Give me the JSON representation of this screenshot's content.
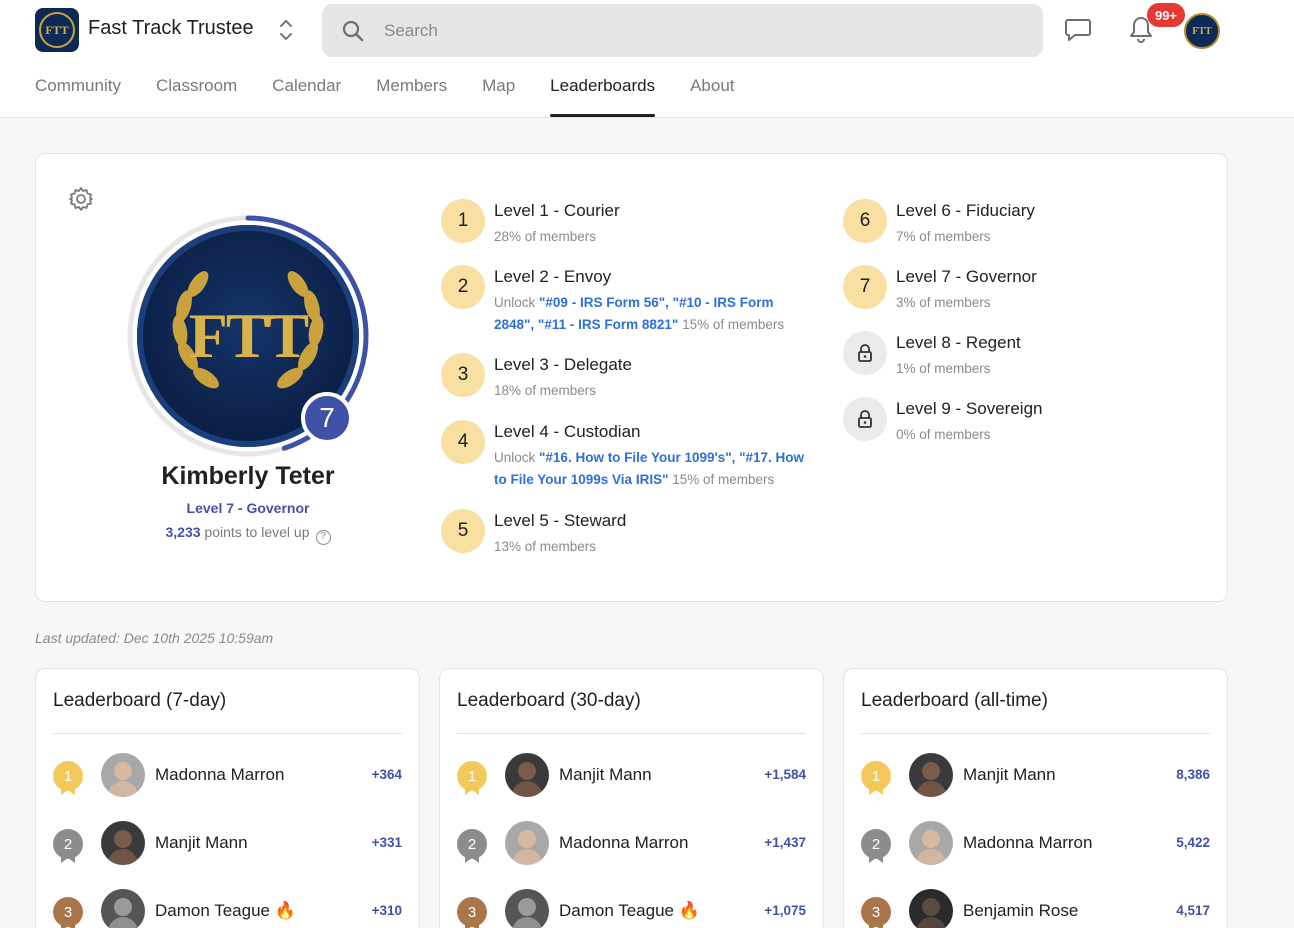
{
  "header": {
    "brand": "Fast Track Trustee",
    "logo_text": "FTT",
    "search_placeholder": "Search",
    "notification_count": "99+",
    "tabs": [
      {
        "label": "Community"
      },
      {
        "label": "Classroom"
      },
      {
        "label": "Calendar"
      },
      {
        "label": "Members"
      },
      {
        "label": "Map"
      },
      {
        "label": "Leaderboards",
        "active": true
      },
      {
        "label": "About"
      }
    ]
  },
  "profile": {
    "avatar_text": "FTT",
    "level_number": "7",
    "name": "Kimberly Teter",
    "level_label": "Level 7 - Governor",
    "points_value": "3,233",
    "points_suffix": "points to level up",
    "level_progress_fraction": 0.45
  },
  "levels": [
    {
      "num": "1",
      "title": "Level 1 - Courier",
      "pct": "28% of members",
      "locked": false
    },
    {
      "num": "2",
      "title": "Level 2 - Envoy",
      "unlock_prefix": "Unlock ",
      "unlock_text": "\"#09 - IRS Form 56\", \"#10 - IRS Form 2848\", \"#11 - IRS Form 8821\"",
      "pct": "15% of members",
      "locked": false
    },
    {
      "num": "3",
      "title": "Level 3 - Delegate",
      "pct": "18% of members",
      "locked": false
    },
    {
      "num": "4",
      "title": "Level 4 - Custodian",
      "unlock_prefix": "Unlock ",
      "unlock_text": "\"#16. How to File Your 1099's\", \"#17. How to File Your 1099s Via IRIS\"",
      "pct": "15% of members",
      "locked": false
    },
    {
      "num": "5",
      "title": "Level 5 - Steward",
      "pct": "13% of members",
      "locked": false
    },
    {
      "num": "6",
      "title": "Level 6 - Fiduciary",
      "pct": "7% of members",
      "locked": false
    },
    {
      "num": "7",
      "title": "Level 7 - Governor",
      "pct": "3% of members",
      "locked": false
    },
    {
      "num": "",
      "title": "Level 8 - Regent",
      "pct": "1% of members",
      "locked": true,
      "icon": "lock-icon"
    },
    {
      "num": "",
      "title": "Level 9 - Sovereign",
      "pct": "0% of members",
      "locked": true,
      "icon": "lock-icon"
    }
  ],
  "last_updated": "Last updated: Dec 10th 2025 10:59am",
  "leaderboards": [
    {
      "title": "Leaderboard (7-day)",
      "rows": [
        {
          "rank": "1",
          "name": "Madonna Marron",
          "points": "+364",
          "fire": false
        },
        {
          "rank": "2",
          "name": "Manjit Mann",
          "points": "+331",
          "fire": false
        },
        {
          "rank": "3",
          "name": "Damon Teague",
          "points": "+310",
          "fire": true
        }
      ]
    },
    {
      "title": "Leaderboard (30-day)",
      "rows": [
        {
          "rank": "1",
          "name": "Manjit Mann",
          "points": "+1,584",
          "fire": false
        },
        {
          "rank": "2",
          "name": "Madonna Marron",
          "points": "+1,437",
          "fire": false
        },
        {
          "rank": "3",
          "name": "Damon Teague",
          "points": "+1,075",
          "fire": true
        }
      ]
    },
    {
      "title": "Leaderboard (all-time)",
      "rows": [
        {
          "rank": "1",
          "name": "Manjit Mann",
          "points": "8,386",
          "fire": false
        },
        {
          "rank": "2",
          "name": "Madonna Marron",
          "points": "5,422",
          "fire": false
        },
        {
          "rank": "3",
          "name": "Benjamin Rose",
          "points": "4,517",
          "fire": false
        }
      ]
    }
  ],
  "colors": {
    "accent": "#4052a8",
    "link": "#2e6fd8",
    "gold": "#f3c95b",
    "silver": "#8c8c8c",
    "bronze": "#a9764b",
    "level_circle": "#f8dfa2",
    "badge_red": "#e53935"
  },
  "fire_emoji": "🔥"
}
